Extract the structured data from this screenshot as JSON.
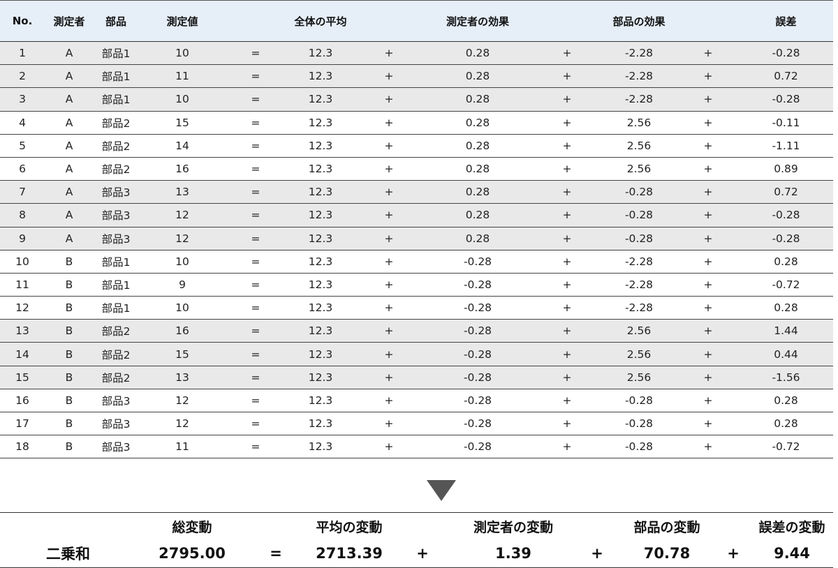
{
  "headers": {
    "no": "No.",
    "measurer": "測定者",
    "part": "部品",
    "value": "測定値",
    "mean": "全体の平均",
    "measurer_effect": "測定者の効果",
    "part_effect": "部品の効果",
    "error": "誤差"
  },
  "operators": {
    "equals": "=",
    "plus": "+"
  },
  "rows": [
    {
      "no": "1",
      "measurer": "A",
      "part": "部品1",
      "value": "10",
      "mean": "12.3",
      "measurer_effect": "0.28",
      "part_effect": "-2.28",
      "error": "-0.28",
      "shaded": true
    },
    {
      "no": "2",
      "measurer": "A",
      "part": "部品1",
      "value": "11",
      "mean": "12.3",
      "measurer_effect": "0.28",
      "part_effect": "-2.28",
      "error": "0.72",
      "shaded": true
    },
    {
      "no": "3",
      "measurer": "A",
      "part": "部品1",
      "value": "10",
      "mean": "12.3",
      "measurer_effect": "0.28",
      "part_effect": "-2.28",
      "error": "-0.28",
      "shaded": true
    },
    {
      "no": "4",
      "measurer": "A",
      "part": "部品2",
      "value": "15",
      "mean": "12.3",
      "measurer_effect": "0.28",
      "part_effect": "2.56",
      "error": "-0.11",
      "shaded": false
    },
    {
      "no": "5",
      "measurer": "A",
      "part": "部品2",
      "value": "14",
      "mean": "12.3",
      "measurer_effect": "0.28",
      "part_effect": "2.56",
      "error": "-1.11",
      "shaded": false
    },
    {
      "no": "6",
      "measurer": "A",
      "part": "部品2",
      "value": "16",
      "mean": "12.3",
      "measurer_effect": "0.28",
      "part_effect": "2.56",
      "error": "0.89",
      "shaded": false
    },
    {
      "no": "7",
      "measurer": "A",
      "part": "部品3",
      "value": "13",
      "mean": "12.3",
      "measurer_effect": "0.28",
      "part_effect": "-0.28",
      "error": "0.72",
      "shaded": true
    },
    {
      "no": "8",
      "measurer": "A",
      "part": "部品3",
      "value": "12",
      "mean": "12.3",
      "measurer_effect": "0.28",
      "part_effect": "-0.28",
      "error": "-0.28",
      "shaded": true
    },
    {
      "no": "9",
      "measurer": "A",
      "part": "部品3",
      "value": "12",
      "mean": "12.3",
      "measurer_effect": "0.28",
      "part_effect": "-0.28",
      "error": "-0.28",
      "shaded": true
    },
    {
      "no": "10",
      "measurer": "B",
      "part": "部品1",
      "value": "10",
      "mean": "12.3",
      "measurer_effect": "-0.28",
      "part_effect": "-2.28",
      "error": "0.28",
      "shaded": false
    },
    {
      "no": "11",
      "measurer": "B",
      "part": "部品1",
      "value": "9",
      "mean": "12.3",
      "measurer_effect": "-0.28",
      "part_effect": "-2.28",
      "error": "-0.72",
      "shaded": false
    },
    {
      "no": "12",
      "measurer": "B",
      "part": "部品1",
      "value": "10",
      "mean": "12.3",
      "measurer_effect": "-0.28",
      "part_effect": "-2.28",
      "error": "0.28",
      "shaded": false
    },
    {
      "no": "13",
      "measurer": "B",
      "part": "部品2",
      "value": "16",
      "mean": "12.3",
      "measurer_effect": "-0.28",
      "part_effect": "2.56",
      "error": "1.44",
      "shaded": true
    },
    {
      "no": "14",
      "measurer": "B",
      "part": "部品2",
      "value": "15",
      "mean": "12.3",
      "measurer_effect": "-0.28",
      "part_effect": "2.56",
      "error": "0.44",
      "shaded": true
    },
    {
      "no": "15",
      "measurer": "B",
      "part": "部品2",
      "value": "13",
      "mean": "12.3",
      "measurer_effect": "-0.28",
      "part_effect": "2.56",
      "error": "-1.56",
      "shaded": true
    },
    {
      "no": "16",
      "measurer": "B",
      "part": "部品3",
      "value": "12",
      "mean": "12.3",
      "measurer_effect": "-0.28",
      "part_effect": "-0.28",
      "error": "0.28",
      "shaded": false
    },
    {
      "no": "17",
      "measurer": "B",
      "part": "部品3",
      "value": "12",
      "mean": "12.3",
      "measurer_effect": "-0.28",
      "part_effect": "-0.28",
      "error": "0.28",
      "shaded": false
    },
    {
      "no": "18",
      "measurer": "B",
      "part": "部品3",
      "value": "11",
      "mean": "12.3",
      "measurer_effect": "-0.28",
      "part_effect": "-0.28",
      "error": "-0.72",
      "shaded": false
    }
  ],
  "summary": {
    "headers": {
      "total": "総変動",
      "mean": "平均の変動",
      "measurer": "測定者の変動",
      "part": "部品の変動",
      "error": "誤差の変動"
    },
    "row_label": "二乗和",
    "values": {
      "total": "2795.00",
      "mean": "2713.39",
      "measurer": "1.39",
      "part": "70.78",
      "error": "9.44"
    }
  },
  "colors": {
    "header_background": "#e6eef8",
    "shaded_row": "#e9e9e9",
    "arrow": "#555555"
  },
  "icons": {
    "arrow": "down-triangle-icon"
  }
}
